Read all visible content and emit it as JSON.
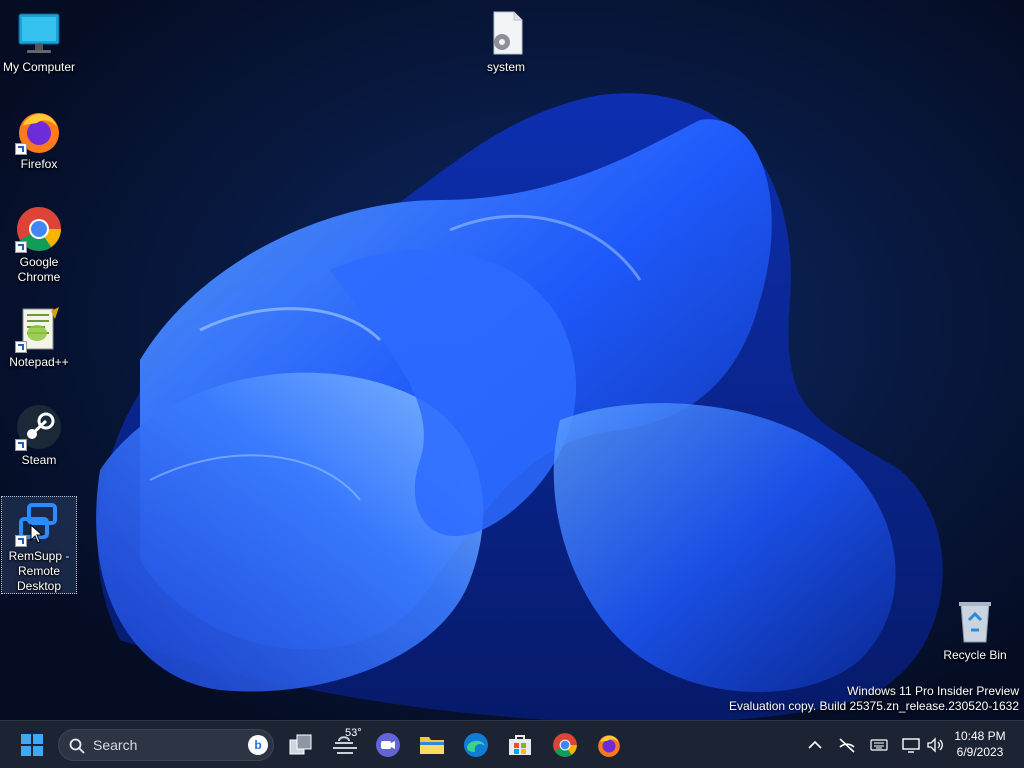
{
  "desktop": {
    "icons": [
      {
        "label": "My Computer",
        "icon": "monitor-icon"
      },
      {
        "label": "Firefox",
        "icon": "firefox-icon"
      },
      {
        "label": "Google Chrome",
        "icon": "chrome-icon"
      },
      {
        "label": "Notepad++",
        "icon": "notepadpp-icon"
      },
      {
        "label": "Steam",
        "icon": "steam-icon"
      },
      {
        "label": "RemSupp - Remote Desktop",
        "icon": "remote-desktop-icon"
      },
      {
        "label": "system",
        "icon": "settings-file-icon"
      },
      {
        "label": "Recycle Bin",
        "icon": "recycle-bin-icon"
      }
    ]
  },
  "watermark": {
    "line1": "Windows 11 Pro Insider Preview",
    "line2": "Evaluation copy. Build 25375.zn_release.230520-1632"
  },
  "taskbar": {
    "search_label": "Search",
    "weather_temp": "53°",
    "apps": [
      "start-icon",
      "task-view-icon",
      "weather-icon",
      "meet-icon",
      "file-explorer-icon",
      "edge-icon",
      "store-icon",
      "chrome-icon",
      "firefox-icon"
    ],
    "tray": [
      "chevron-up-icon",
      "network-off-icon",
      "keyboard-icon",
      "display-icon",
      "volume-icon"
    ],
    "clock": {
      "time": "10:48 PM",
      "date": "6/9/2023"
    }
  }
}
